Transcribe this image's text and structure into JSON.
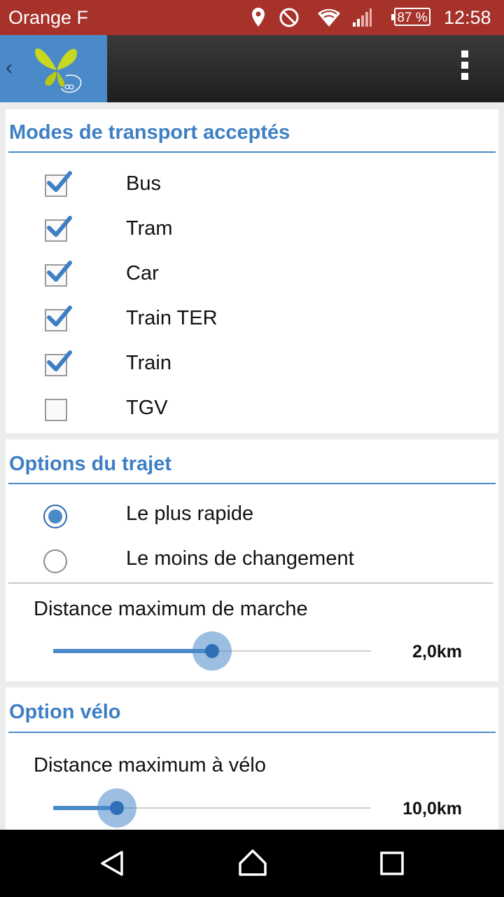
{
  "status_bar": {
    "carrier": "Orange F",
    "battery": "87 %",
    "time": "12:58"
  },
  "app_bar": {
    "brand_color": "#4a8ac9"
  },
  "transport": {
    "title": "Modes de transport acceptés",
    "items": [
      {
        "label": "Bus",
        "checked": true
      },
      {
        "label": "Tram",
        "checked": true
      },
      {
        "label": "Car",
        "checked": true
      },
      {
        "label": "Train TER",
        "checked": true
      },
      {
        "label": "Train",
        "checked": true
      },
      {
        "label": "TGV",
        "checked": false
      }
    ]
  },
  "trip": {
    "title": "Options du trajet",
    "options": [
      {
        "label": "Le plus rapide",
        "selected": true
      },
      {
        "label": "Le moins de changement",
        "selected": false
      }
    ],
    "walk_label": "Distance maximum de marche",
    "walk_value": "2,0km",
    "walk_fraction": 0.5
  },
  "bike": {
    "title": "Option vélo",
    "label": "Distance maximum à vélo",
    "value": "10,0km",
    "fraction": 0.2
  },
  "colors": {
    "status_bar": "#a6322a",
    "accent": "#3e7fc4"
  }
}
